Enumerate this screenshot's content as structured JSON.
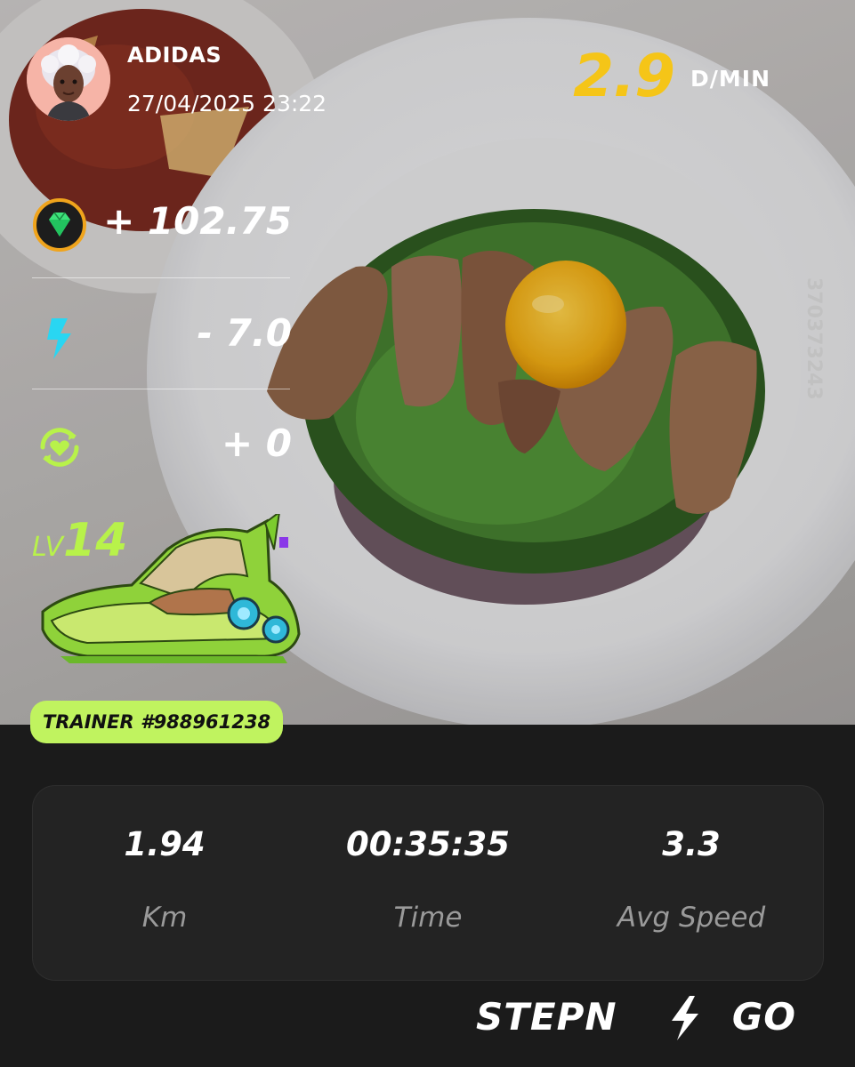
{
  "user": {
    "name": "ADIDAS",
    "datetime": "27/04/2025 23:22"
  },
  "rate": {
    "value": "2.9",
    "unit": "D/MIN"
  },
  "stats": {
    "gst": "+ 102.75",
    "energy": "- 7.0",
    "health": "+ 0"
  },
  "level": {
    "prefix": "LV",
    "number": "14"
  },
  "trainer_label": "TRAINER #988961238",
  "photo_overlay_code": "370373243",
  "summary": {
    "distance_value": "1.94",
    "distance_label": "Km",
    "time_value": "00:35:35",
    "time_label": "Time",
    "speed_value": "3.3",
    "speed_label": "Avg Speed"
  },
  "brand": {
    "left": "STEPN",
    "right": "GO"
  },
  "colors": {
    "accent_yellow": "#f5c518",
    "accent_green": "#b8f24a",
    "trainer_badge": "#c0f35f",
    "energy_cyan": "#29d6f2",
    "background_dark": "#1b1b1b",
    "card": "#232323"
  },
  "icons": {
    "gst": "diamond-coin-icon",
    "energy": "lightning-icon",
    "health": "heart-cycle-icon",
    "brand_bolt": "lightning-bolt-icon"
  }
}
